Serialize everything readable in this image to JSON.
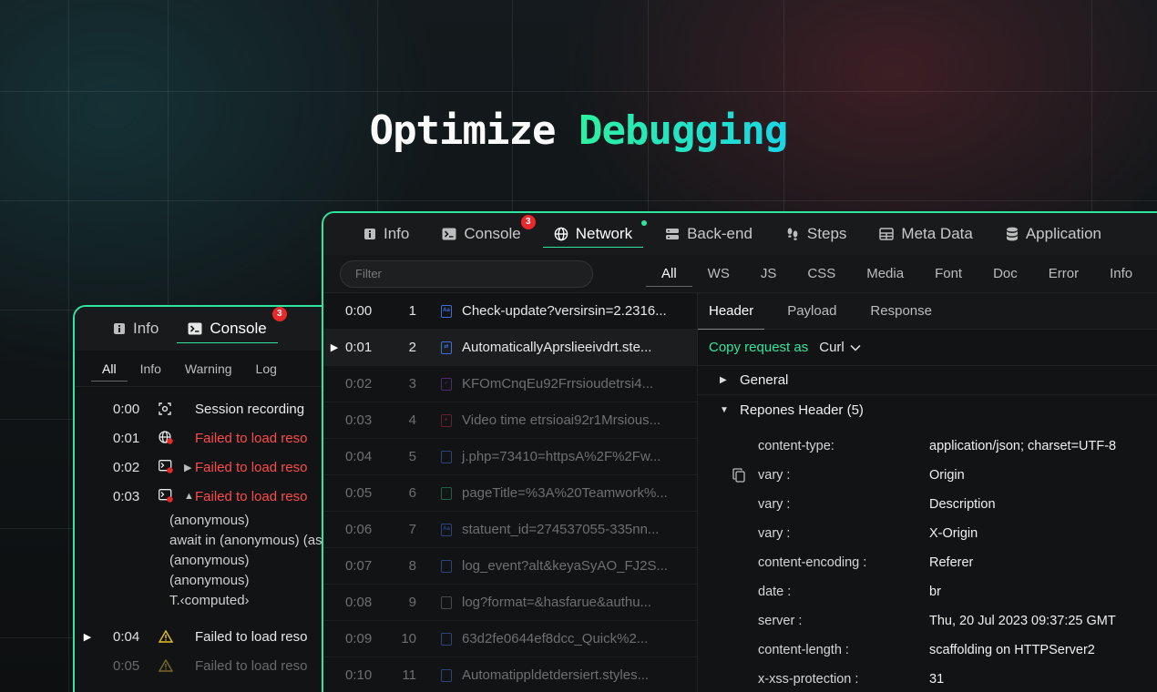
{
  "headline": {
    "part1": "Optimize",
    "part2": "Debugging"
  },
  "back_panel": {
    "tabs": [
      {
        "label": "Info",
        "icon": "info-icon"
      },
      {
        "label": "Console",
        "icon": "terminal-icon",
        "badge": "3"
      }
    ],
    "filters": [
      "All",
      "Info",
      "Warning",
      "Log"
    ],
    "rows": [
      {
        "time": "0:00",
        "icon": "scan-icon",
        "msg": "Session recording"
      },
      {
        "time": "0:01",
        "icon": "globe-error-icon",
        "msg": "Failed to load reso"
      },
      {
        "time": "0:02",
        "icon": "terminal-error-icon",
        "msg": "Failed to load reso"
      },
      {
        "time": "0:03",
        "icon": "terminal-error-icon",
        "msg": "Failed to load reso"
      }
    ],
    "trace": [
      "(anonymous)",
      "await in (anonymous) (as",
      "(anonymous)",
      "(anonymous)",
      "T.‹computed›"
    ],
    "rows2": [
      {
        "time": "0:04",
        "icon": "warning-icon",
        "msg": "Failed to load reso"
      },
      {
        "time": "0:05",
        "icon": "warning-icon",
        "msg": "Failed to load reso"
      }
    ]
  },
  "front_panel": {
    "tabs": [
      {
        "label": "Info",
        "icon": "info-icon"
      },
      {
        "label": "Console",
        "icon": "terminal-icon",
        "badge": "3"
      },
      {
        "label": "Network",
        "icon": "globe-icon"
      },
      {
        "label": "Back-end",
        "icon": "server-icon"
      },
      {
        "label": "Steps",
        "icon": "footsteps-icon"
      },
      {
        "label": "Meta Data",
        "icon": "table-icon"
      },
      {
        "label": "Application",
        "icon": "database-icon"
      }
    ],
    "filter_placeholder": "Filter",
    "type_filters": [
      "All",
      "WS",
      "JS",
      "CSS",
      "Media",
      "Font",
      "Doc",
      "Error",
      "Info"
    ],
    "requests": [
      {
        "time": "0:00",
        "num": "1",
        "name": "Check-update?versirsin=2.2316...",
        "icon_color": "#3b6fd9",
        "glyph": "Aa"
      },
      {
        "time": "0:01",
        "num": "2",
        "name": "AutomaticallyAprslieeivdrt.ste...",
        "icon_color": "#3b6fd9",
        "glyph": "⇄"
      },
      {
        "time": "0:02",
        "num": "3",
        "name": "KFOmCnqEu92Frrsioudetrsi4...",
        "icon_color": "#8a3bc4",
        "glyph": "✓"
      },
      {
        "time": "0:03",
        "num": "4",
        "name": "Video time etrsioai92r1Mrsious...",
        "icon_color": "#b02a4a",
        "glyph": "▸"
      },
      {
        "time": "0:04",
        "num": "5",
        "name": "j.php=73410=httpsA%2F%2Fw...",
        "icon_color": "#3b6fd9",
        "glyph": "DOC"
      },
      {
        "time": "0:05",
        "num": "6",
        "name": "pageTitle=%3A%20Teamwork%...",
        "icon_color": "#2aa36a",
        "glyph": "↑"
      },
      {
        "time": "0:06",
        "num": "7",
        "name": "statuent_id=274537055-335nn...",
        "icon_color": "#3b6fd9",
        "glyph": "Aa"
      },
      {
        "time": "0:07",
        "num": "8",
        "name": "log_event?alt&keyaSyAO_FJ2S...",
        "icon_color": "#3b6fd9",
        "glyph": "DOC"
      },
      {
        "time": "0:08",
        "num": "9",
        "name": "log?format=&hasfarue&authu...",
        "icon_color": "#777777",
        "glyph": "PDF"
      },
      {
        "time": "0:09",
        "num": "10",
        "name": "63d2fe0644ef8dcc_Quick%2...",
        "icon_color": "#3b6fd9",
        "glyph": "DOC"
      },
      {
        "time": "0:10",
        "num": "11",
        "name": "Automatippldetdersiert.styles...",
        "icon_color": "#3b6fd9",
        "glyph": "DOC"
      }
    ],
    "detail_tabs": [
      "Header",
      "Payload",
      "Response"
    ],
    "copy_label": "Copy request as",
    "copy_format": "Curl",
    "section_general": "General",
    "section_response": "Repones Header (5)",
    "headers": [
      {
        "k": "content-type:",
        "v": "application/json; charset=UTF-8"
      },
      {
        "k": "vary :",
        "v": "Origin"
      },
      {
        "k": "vary :",
        "v": "Description"
      },
      {
        "k": "vary :",
        "v": "X-Origin"
      },
      {
        "k": "content-encoding :",
        "v": "Referer"
      },
      {
        "k": "date :",
        "v": "br"
      },
      {
        "k": "server :",
        "v": "Thu, 20 Jul 2023 09:37:25 GMT"
      },
      {
        "k": "content-length :",
        "v": "scaffolding on HTTPServer2"
      },
      {
        "k": "x-xss-protection :",
        "v": "31"
      }
    ]
  },
  "colors": {
    "accent": "#2ee6a0",
    "error": "#ff4a4a",
    "warning": "#e6c229",
    "badge": "#e8282b"
  }
}
